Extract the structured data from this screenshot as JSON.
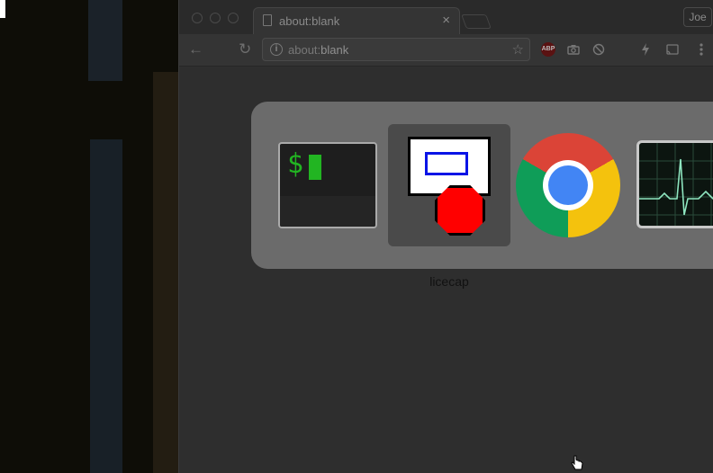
{
  "tab": {
    "title": "about:blank",
    "close": "×"
  },
  "profile": {
    "name": "Joe"
  },
  "omnibox": {
    "url_prefix": "about:",
    "url_host": "blank"
  },
  "toolbar": {
    "back": "←",
    "reload": "↻",
    "star": "☆"
  },
  "switcher": {
    "apps": [
      {
        "icon": "terminal-icon",
        "prompt": "$"
      },
      {
        "icon": "licecap-icon",
        "label": "licecap",
        "selected": true
      },
      {
        "icon": "chrome-icon"
      },
      {
        "icon": "activity-monitor-icon"
      }
    ]
  },
  "colors": {
    "switcher_bg": "#6b6b6b",
    "terminal_green": "#22b522",
    "licecap_red": "#ff0000",
    "licecap_blue": "#0a14e6"
  }
}
